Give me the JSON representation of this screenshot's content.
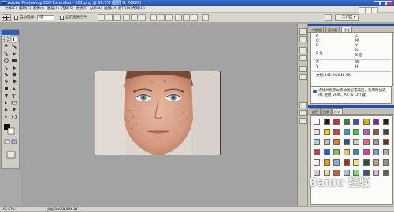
{
  "window": {
    "title": "Adobe Photoshop CS3 Extended - 161.png @ 66.7% (图层 0, RGB/8)"
  },
  "menu": {
    "items": [
      "文件(F)",
      "编辑(E)",
      "图像(I)",
      "图层(L)",
      "选择(S)",
      "滤镜(T)",
      "分析(A)",
      "视图(V)",
      "窗口(W)",
      "帮助(H)"
    ],
    "workspace_label": "工作区 ▾"
  },
  "options": {
    "auto_select_label": "自动选择:",
    "auto_select_value": "组",
    "show_transform_label": "显示变换控件"
  },
  "tabs": {
    "top": [
      "导航器",
      "直方图",
      "信息"
    ],
    "bottom": [
      "颜色",
      "色板",
      "样式"
    ]
  },
  "info": {
    "r_label": "R:",
    "g_label": "G:",
    "b_label": "B:",
    "c_label": "C:",
    "m_label": "M:",
    "y_label": "Y:",
    "k_label": "K:",
    "bit_left": "8 位",
    "bit_right": "8 位",
    "x_label": "X:",
    "y2_label": "Y:",
    "w_label": "W:",
    "h_label": "H:",
    "doc_label": "文档:846.9K/846.9K",
    "hint_text": "点按并拖移以移动图层或选区。要用附加选项, 使用 Shift、Alt 和 Ctrl 键。"
  },
  "status": {
    "zoom": "66.67%",
    "doc": "文档:846.9K/846.9K"
  },
  "watermark": "Baidu 经验",
  "colors": {
    "title_blue": "#1e4fa5",
    "panel_header_blue": "#1f4ea8",
    "swatches": [
      "#ffffff",
      "#1a1a1a",
      "#c23030",
      "#3a7a3a",
      "#3050c0",
      "#d0b020",
      "#7a2aa0",
      "#202020",
      "#e0e0e0",
      "#f0d020",
      "#cc4040",
      "#30a0c0",
      "#50c050",
      "#b060c0",
      "#806040",
      "#404040",
      "#9fd0f0",
      "#c0c0c0",
      "#e08030",
      "#305080",
      "#d0d0d0",
      "#f06090",
      "#a0a0a0",
      "#603020",
      "#c04050",
      "#2060c0",
      "#80c060",
      "#e0c060",
      "#4080d0",
      "#d040a0",
      "#70a0d0",
      "#b0b0b0",
      "#f0f0f0",
      "#e0a020",
      "#80b0e0",
      "#a03030",
      "#f0e080",
      "#305030",
      "#c0a080",
      "#909090",
      "#c0d0e0",
      "#e0e0a0",
      "#d06030",
      "#a0c0e0",
      "#70e070",
      "#405080",
      "#e0b0d0",
      "#606060"
    ]
  }
}
